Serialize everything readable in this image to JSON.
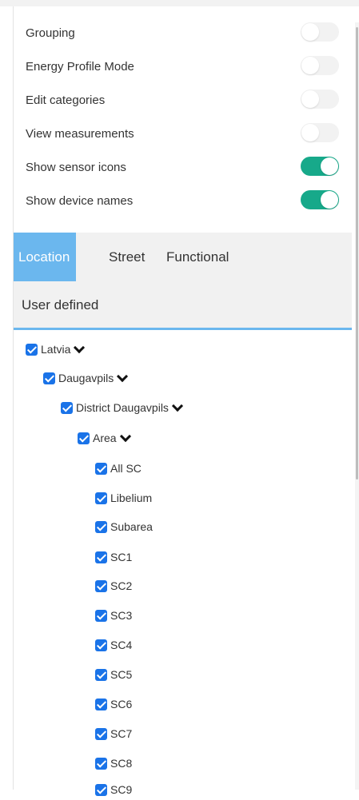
{
  "settings": [
    {
      "label": "Grouping",
      "on": false
    },
    {
      "label": "Energy Profile Mode",
      "on": false
    },
    {
      "label": "Edit categories",
      "on": false
    },
    {
      "label": "View measurements",
      "on": false
    },
    {
      "label": "Show sensor icons",
      "on": true
    },
    {
      "label": "Show device names",
      "on": true
    }
  ],
  "tabs": {
    "location": "Location",
    "street": "Street",
    "functional": "Functional",
    "user_defined": "User defined"
  },
  "tree": {
    "latvia": "Latvia",
    "daugavpils": "Daugavpils",
    "district": "District Daugavpils",
    "area": "Area",
    "items": [
      "All SC",
      "Libelium",
      "Subarea",
      "SC1",
      "SC2",
      "SC3",
      "SC4",
      "SC5",
      "SC6",
      "SC7",
      "SC8",
      "SC9"
    ]
  },
  "colors": {
    "toggle_on": "#17a98a",
    "tab_active": "#6bb7ee",
    "checkbox": "#1a73e8"
  }
}
